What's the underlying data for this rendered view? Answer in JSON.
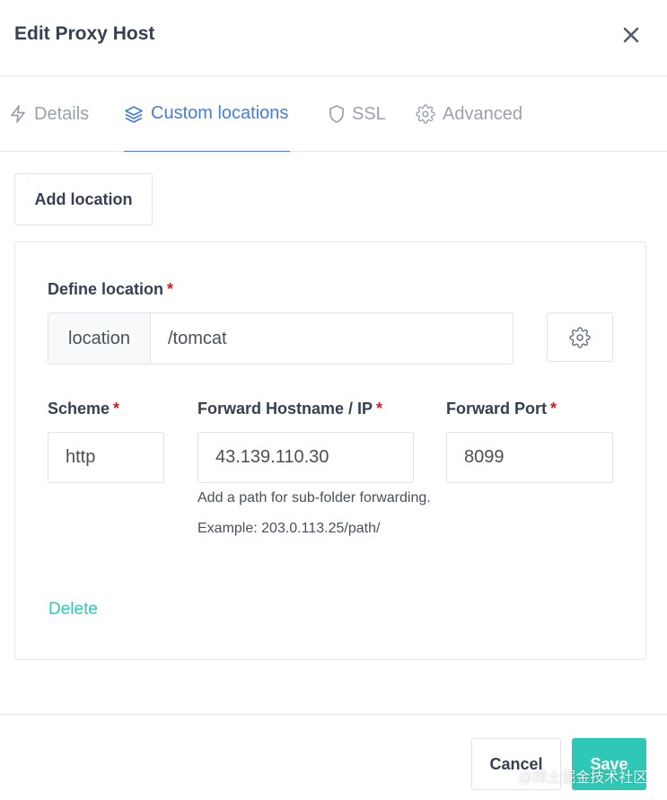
{
  "modal": {
    "title": "Edit Proxy Host",
    "close_icon": "close-icon"
  },
  "tabs": [
    {
      "label": "Details",
      "icon": "bolt-icon",
      "active": false
    },
    {
      "label": "Custom locations",
      "icon": "layers-icon",
      "active": true
    },
    {
      "label": "SSL",
      "icon": "shield-icon",
      "active": false
    },
    {
      "label": "Advanced",
      "icon": "gear-icon",
      "active": false
    }
  ],
  "add_location_label": "Add location",
  "location": {
    "define_label": "Define location",
    "required_mark": "*",
    "prefix": "location",
    "path_value": "/tomcat",
    "settings_icon": "gear-icon"
  },
  "forward": {
    "scheme_label": "Scheme",
    "scheme_value": "http",
    "hostname_label": "Forward Hostname / IP",
    "hostname_value": "43.139.110.30",
    "port_label": "Forward Port",
    "port_value": "8099",
    "help_text": "Add a path for sub-folder forwarding. Example: 203.0.113.25/path/",
    "required_mark": "*"
  },
  "delete_label": "Delete",
  "footer": {
    "cancel_label": "Cancel",
    "save_label": "Save"
  },
  "watermark": "@稀土掘金技术社区",
  "colors": {
    "accent": "#467fcf",
    "teal": "#2fc8b6",
    "required": "#cd201f",
    "muted": "#9aa0ac"
  }
}
